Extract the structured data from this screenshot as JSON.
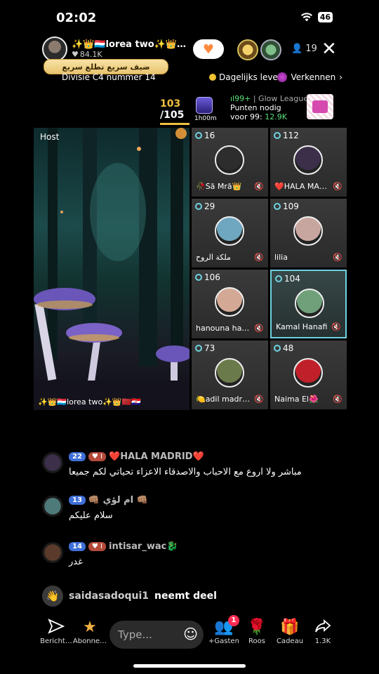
{
  "status": {
    "time": "02:02",
    "battery": "46"
  },
  "host": {
    "name": "✨👑🇱🇺lorea two✨👑…",
    "likes": "84.1K",
    "banner": "ضيف سريع تطلع سريع",
    "division": "Divisie C4 nummer 14",
    "daily": "Dagelijks leven",
    "explore": "Verkennen"
  },
  "viewers": {
    "count": "19"
  },
  "rank": {
    "current": "103",
    "total": "/105",
    "timer": "1h00m"
  },
  "league": {
    "line1_pts": "99+",
    "line1_name": "| Glow League",
    "line2": "Punten nodig",
    "line3_prefix": "voor 99:",
    "line3_value": "12.9K"
  },
  "stage": {
    "host_label": "Host",
    "host_footer": "✨👑🇱🇺lorea two✨👑🇲🇦🇭🇷",
    "guests": [
      {
        "num": "16",
        "name": "🥀Să Mră👑",
        "avatar_color": "#2d2d2d",
        "selected": false
      },
      {
        "num": "112",
        "name": "❤️HALA MAD…",
        "avatar_color": "#3b2f4a",
        "selected": false
      },
      {
        "num": "29",
        "name": "ملكة الروح",
        "avatar_color": "#6fa6c0",
        "selected": false
      },
      {
        "num": "109",
        "name": "lilia",
        "avatar_color": "#c8a6a0",
        "selected": false
      },
      {
        "num": "106",
        "name": "hanouna ha…",
        "avatar_color": "#d3a995",
        "selected": false
      },
      {
        "num": "104",
        "name": "Kamal Hanafi",
        "avatar_color": "#6fa07a",
        "selected": true
      },
      {
        "num": "73",
        "name": "🍋adil madri…",
        "avatar_color": "#6a7a4a",
        "selected": false
      },
      {
        "num": "48",
        "name": "Naima El🌺",
        "avatar_color": "#c0202a",
        "selected": false
      }
    ]
  },
  "chat": [
    {
      "level": "22",
      "fan": "I",
      "name": "❤️HALA MADRID❤️",
      "text": "مباشر ولا اروع مع الاحباب والاصدقاء الاعزاء تحياتي لكم جميعا",
      "avatar_color": "#3b2f4a"
    },
    {
      "level": "13",
      "fan": "",
      "name": "👊🏽 ام لؤي 👊🏽",
      "text": "سلام عليكم",
      "avatar_color": "#4f7a7a"
    },
    {
      "level": "14",
      "fan": "I",
      "name": "intisar_wac🐉",
      "text": "غدر",
      "avatar_color": "#5a3a2a"
    }
  ],
  "join": {
    "user": "saidasadoqui1",
    "text": "neemt deel"
  },
  "bottom": {
    "message": "Bericht…",
    "subscribe": "Abonne…",
    "type_placeholder": "Type...",
    "guests": "+Gasten",
    "guests_badge": "1",
    "roses": "Roos",
    "gift": "Cadeau",
    "share": "1.3K"
  },
  "colors": {
    "accent_cyan": "#6fd3e0",
    "gold": "#f0c040",
    "league_green": "#59e07a",
    "badge_red": "#ff2d55"
  }
}
